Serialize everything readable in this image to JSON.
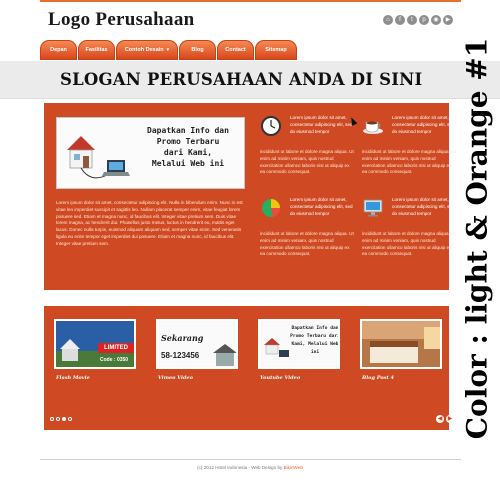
{
  "logo": "Logo Perusahaan",
  "social_icons": [
    "home-icon",
    "facebook-icon",
    "twitter-icon",
    "pinterest-icon",
    "rss-icon",
    "youtube-icon"
  ],
  "nav": {
    "items": [
      {
        "label": "Depan",
        "name": "nav-depan"
      },
      {
        "label": "Fasilitas",
        "name": "nav-fasilitas"
      },
      {
        "label": "Contoh Desain",
        "name": "nav-contoh-desain"
      },
      {
        "label": "Blog",
        "name": "nav-blog"
      },
      {
        "label": "Contact",
        "name": "nav-contact"
      },
      {
        "label": "Sitemap",
        "name": "nav-sitemap"
      }
    ]
  },
  "slogan": "SLOGAN PERUSAHAAN ANDA DI SINI",
  "side_caption": "Color : light & Orange #1",
  "banner": {
    "line1": "Dapatkan Info dan",
    "line2": "Promo Terbaru",
    "line3": "dari Kami,",
    "line4": "Melalui Web ini"
  },
  "intro_text": "Lorem ipsum dolor sit amet, consectetur adipiscing elit. Nulla in bibendum enim. Nunc in est vitae leo imperdiet suscipit et sagittis leo. Nullam placerat semper enim, vitae feugiat lorem posuere sed. Etiam et magna nunc, id faucibus elit. Integer vitae pretium sem. Duis vitae lorem magna, ac hendrerit dui. Phasellus justo metus, luctus in hendrerit eu, mattis eget lacus. Donec nulla turpis, euismod aliquam aliquam sed, semper vitae enim. Sed venenatis ligula eu enim tempor eget imperdiet dui posuere. Etiam et magna nunc, id faucibus elit. Integer vitae pretium sem.",
  "features": [
    {
      "icon": "clock-icon",
      "head": "Lorem ipsum dolor sit amet, consectetur adipiscing elit, sed do eiusmod tempor",
      "body": "incididunt ut labore et dolore magna aliqua. Ut enim ad minim veniam, quis nostrud exercitation ullamco laboris nisi ut aliquip ex ea commodo consequat."
    },
    {
      "icon": "coffee-cup-icon",
      "head": "Lorem ipsum dolor sit amet, consectetur adipiscing elit, sed do eiusmod tempor",
      "body": "incididunt ut labore et dolore magna aliqua. Ut enim ad minim veniam, quis nostrud exercitation ullamco laboris nisi ut aliquip ex ea commodo consequat."
    },
    {
      "icon": "pie-chart-icon",
      "head": "Lorem ipsum dolor sit amet, consectetur adipiscing elit, sed do eiusmod tempor",
      "body": "incididunt ut labore et dolore magna aliqua. Ut enim ad minim veniam, quis nostrud exercitation ullamco laboris nisi ut aliquip ex ea commodo consequat."
    },
    {
      "icon": "monitor-icon",
      "head": "Lorem ipsum dolor sit amet, consectetur adipiscing elit, sed do eiusmod tempor",
      "body": "incididunt ut labore et dolore magna aliqua. Ut enim ad minim veniam, quis nostrud exercitation ullamco laboris nisi ut aliquip ex ea commodo consequat."
    }
  ],
  "gallery": [
    {
      "caption": "Flash Movie",
      "thumb_text": "Code : 0350",
      "thumb_badge": "LIMITED"
    },
    {
      "caption": "Vimeo Video",
      "thumb_text": "Sekarang",
      "thumb_badge": "58-123456"
    },
    {
      "caption": "Youtube Video",
      "thumb_text": "Dapatkan Info dan Promo Terbaru dari Kami, Melalui Web ini",
      "thumb_badge": ""
    },
    {
      "caption": "Blog Post 4",
      "thumb_text": "",
      "thumb_badge": ""
    }
  ],
  "slider_dots": 4,
  "slider_active": 3,
  "footer": {
    "prefix": "(c) 2012 Hotel Indonesia - Web Design by ",
    "credit": "BikinWeb"
  },
  "colors": {
    "accent": "#cf4a22",
    "nav": "#e76f2c",
    "band": "#ebebeb"
  }
}
